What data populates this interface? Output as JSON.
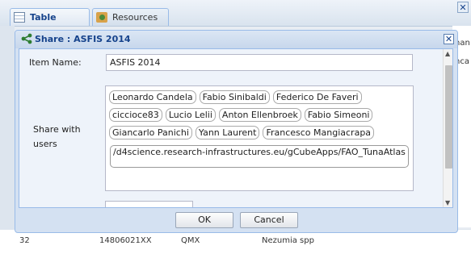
{
  "tabs": [
    {
      "label": "Table",
      "icon": "table-icon"
    },
    {
      "label": "Resources",
      "icon": "resources-icon"
    }
  ],
  "background": {
    "right_column_fragments": [
      "nan",
      "nca"
    ],
    "row": {
      "c1": "32",
      "c2": "14806021XX",
      "c3": "QMX",
      "c4": "Nezumia spp"
    },
    "close_glyph": "✕"
  },
  "dialog": {
    "title": "Share : ASFIS 2014",
    "close_glyph": "✕",
    "item_name_label": "Item Name:",
    "item_name_value": "ASFIS 2014",
    "share_with_label_line1": "Share with",
    "share_with_label_line2": "users",
    "users": [
      "Leonardo Candela",
      "Fabio Sinibaldi",
      "Federico De Faveri",
      "ciccioce83",
      "Lucio Lelii",
      "Anton Ellenbroek",
      "Fabio Simeoni",
      "Giancarlo Panichi",
      "Yann Laurent",
      "Francesco Mangiacrapa"
    ],
    "url_text": "/d4science.research-infrastructures.eu/gCubeApps/FAO_TunaAtlas",
    "ok_label": "OK",
    "cancel_label": "Cancel"
  },
  "colors": {
    "title": "#15428b",
    "dialog_bg": "#d4e1f2",
    "border": "#99bbe8"
  }
}
